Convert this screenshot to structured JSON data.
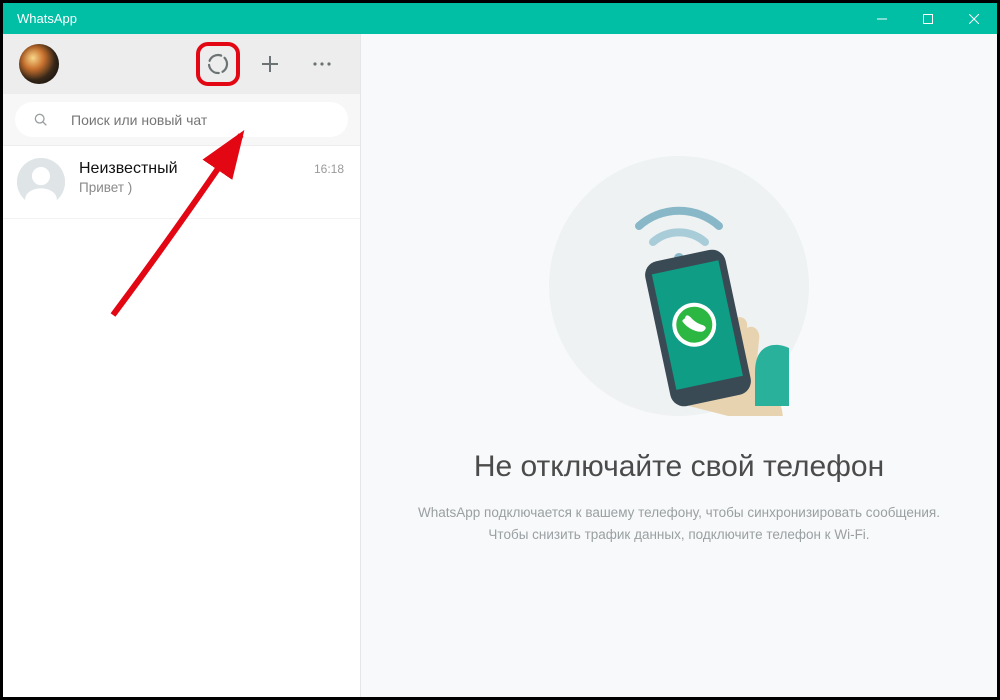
{
  "window": {
    "title": "WhatsApp"
  },
  "search": {
    "placeholder": "Поиск или новый чат"
  },
  "chats": [
    {
      "name": "Неизвестный",
      "preview": "Привет )",
      "time": "16:18"
    }
  ],
  "main": {
    "headline": "Не отключайте свой телефон",
    "subline": "WhatsApp подключается к вашему телефону, чтобы синхронизировать сообщения. Чтобы снизить трафик данных, подключите телефон к Wi-Fi."
  },
  "icons": {
    "status": "status-icon",
    "new_chat": "new-chat-icon",
    "menu": "menu-icon",
    "search": "search-icon"
  }
}
